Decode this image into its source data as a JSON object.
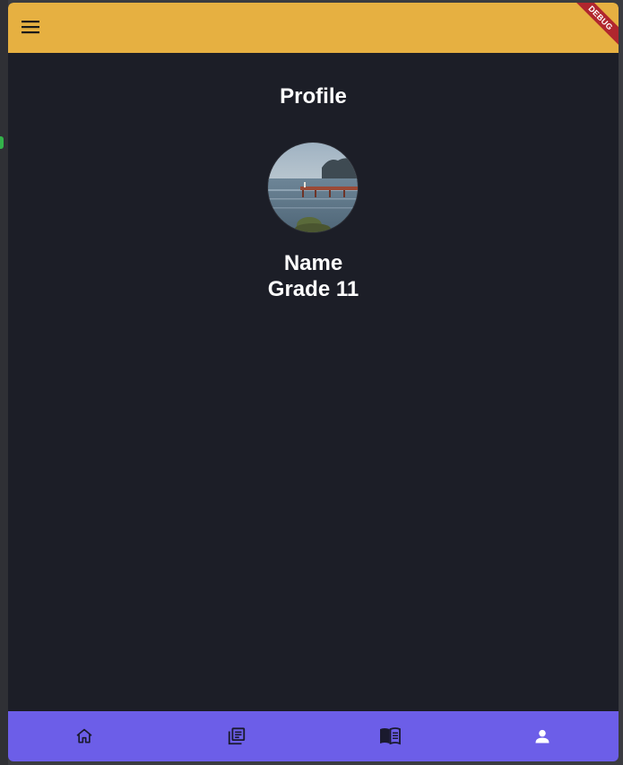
{
  "app_bar": {
    "menu_icon": "menu-icon",
    "color": "#e6b041",
    "debug_banner": "DEBUG"
  },
  "page": {
    "title": "Profile",
    "background": "#1c1e27"
  },
  "profile": {
    "avatar_icon": "profile-photo",
    "name": "Name",
    "grade": "Grade 11"
  },
  "bottom_nav": {
    "color": "#6c5ee8",
    "items": [
      {
        "icon": "home-icon",
        "selected": false
      },
      {
        "icon": "library-books-icon",
        "selected": false
      },
      {
        "icon": "menu-book-icon",
        "selected": false
      },
      {
        "icon": "person-icon",
        "selected": true
      }
    ]
  }
}
